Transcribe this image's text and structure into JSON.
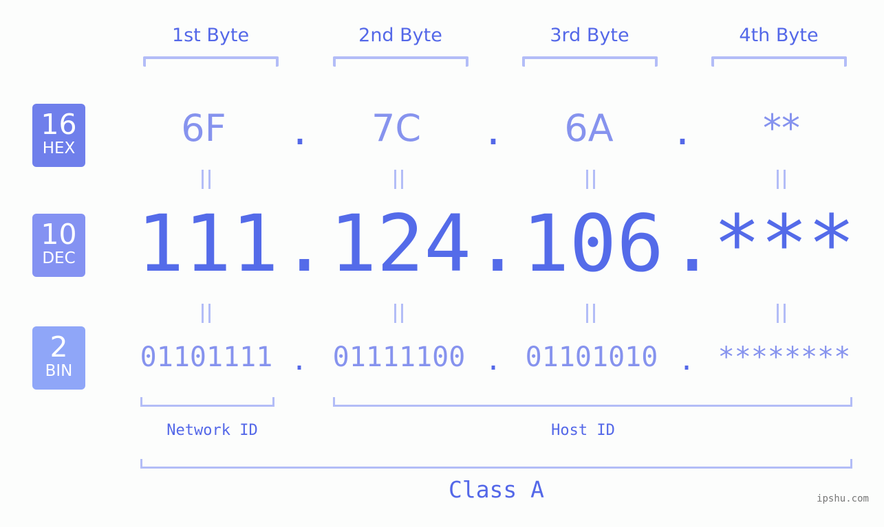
{
  "colors": {
    "accent": "#5468e8",
    "light_value": "#8693ee",
    "bracket": "#b3bdf7",
    "hex_badge": "#6f7feb",
    "dec_badge": "#8492f2",
    "bin_badge": "#8fa6f8",
    "background": "#fcfdfc",
    "watermark": "#777777"
  },
  "bytes": [
    {
      "label": "1st Byte",
      "hex": "6F",
      "dec": "111",
      "bin": "01101111"
    },
    {
      "label": "2nd Byte",
      "hex": "7C",
      "dec": "124",
      "bin": "01111100"
    },
    {
      "label": "3rd Byte",
      "hex": "6A",
      "dec": "106",
      "bin": "01101010"
    },
    {
      "label": "4th Byte",
      "hex": "**",
      "dec": "***",
      "bin": "********"
    }
  ],
  "separator": ".",
  "bases": {
    "hex": {
      "num": "16",
      "label": "HEX"
    },
    "dec": {
      "num": "10",
      "label": "DEC"
    },
    "bin": {
      "num": "2",
      "label": "BIN"
    }
  },
  "network_id_label": "Network ID",
  "host_id_label": "Host ID",
  "class_label": "Class A",
  "watermark": "ipshu.com"
}
